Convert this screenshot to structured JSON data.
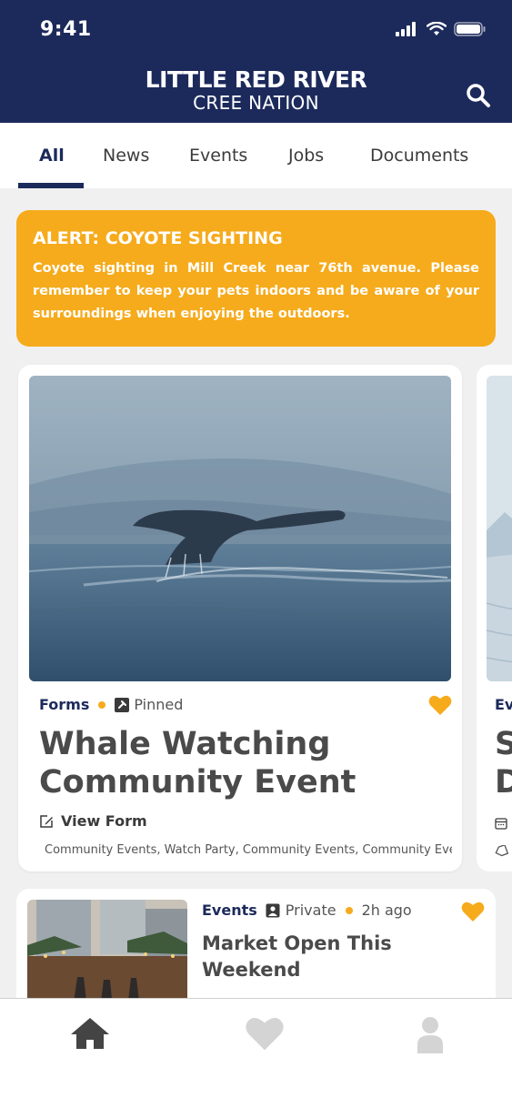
{
  "status_bar": {
    "time": "9:41"
  },
  "header": {
    "logo_line1": "LITTLE RED RIVER",
    "logo_line2": "CREE NATION"
  },
  "tabs": [
    {
      "label": "All",
      "active": true
    },
    {
      "label": "News"
    },
    {
      "label": "Events"
    },
    {
      "label": "Jobs"
    },
    {
      "label": "Documents"
    }
  ],
  "alert": {
    "title": "ALERT: COYOTE SIGHTING",
    "body": "Coyote sighting in Mill Creek near 76th avenue. Please remember to keep your pets indoors and be aware of your surroundings when enjoying the outdoors."
  },
  "featured_card": {
    "category": "Forms",
    "pinned_label": "Pinned",
    "title": "Whale Watching Community Event",
    "action_label": "View Form",
    "tags": "Community Events, Watch Party, Community Events, Community Events"
  },
  "peek_card": {
    "category": "Ev",
    "title_line1": "S",
    "title_line2": "D"
  },
  "list_card": {
    "category": "Events",
    "privacy": "Private",
    "time_ago": "2h ago",
    "title": "Market Open This Weekend"
  },
  "colors": {
    "navy": "#1c2a5b",
    "accent": "#f6ab1c",
    "feed_bg": "#f0f0f0"
  },
  "icons": {
    "header": "search-icon",
    "status": [
      "signal-icon",
      "wifi-icon",
      "battery-icon"
    ],
    "nav": [
      "home-icon",
      "heart-icon",
      "profile-icon"
    ]
  }
}
